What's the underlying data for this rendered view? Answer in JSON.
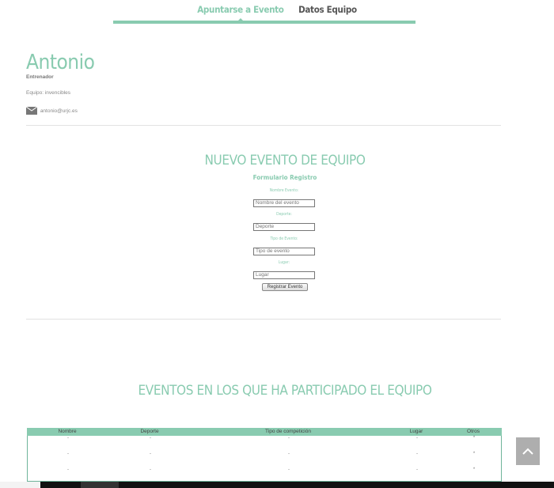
{
  "nav": {
    "tabs": [
      {
        "label": "Apuntarse a Evento",
        "active": true
      },
      {
        "label": "Datos Equipo",
        "active": false
      }
    ]
  },
  "profile": {
    "name": "Antonio",
    "role": "Entrenador",
    "team": "Equipo: invencibles",
    "email": "antonio@urjc.es"
  },
  "form": {
    "title": "NUEVO EVENTO DE EQUIPO",
    "subtitle": "Formulario Registro",
    "fields": [
      {
        "label": "Nombre Evento:",
        "placeholder": "Nombre del evento"
      },
      {
        "label": "Deporte:",
        "placeholder": "Deporte"
      },
      {
        "label": "Tipo de Evento:",
        "placeholder": "Tipo de evento"
      },
      {
        "label": "Lugar:",
        "placeholder": "Lugar"
      }
    ],
    "submit_label": "Registrar Evento"
  },
  "events": {
    "title": "EVENTOS EN LOS QUE HA PARTICIPADO EL EQUIPO",
    "columns": [
      "Nombre",
      "Deporte",
      "Tipo de competición",
      "Lugar",
      "Otros"
    ],
    "rows": [
      [
        "-",
        "-",
        "-",
        "-",
        "*"
      ],
      [
        "-",
        "-",
        "-",
        "-",
        "*"
      ],
      [
        "-",
        "-",
        "-",
        "-",
        "*"
      ]
    ]
  },
  "colors": {
    "accent": "#89cbb0",
    "text": "#555555"
  },
  "icons": {
    "email": "envelope-icon",
    "scroll_top": "chevron-up-icon"
  }
}
